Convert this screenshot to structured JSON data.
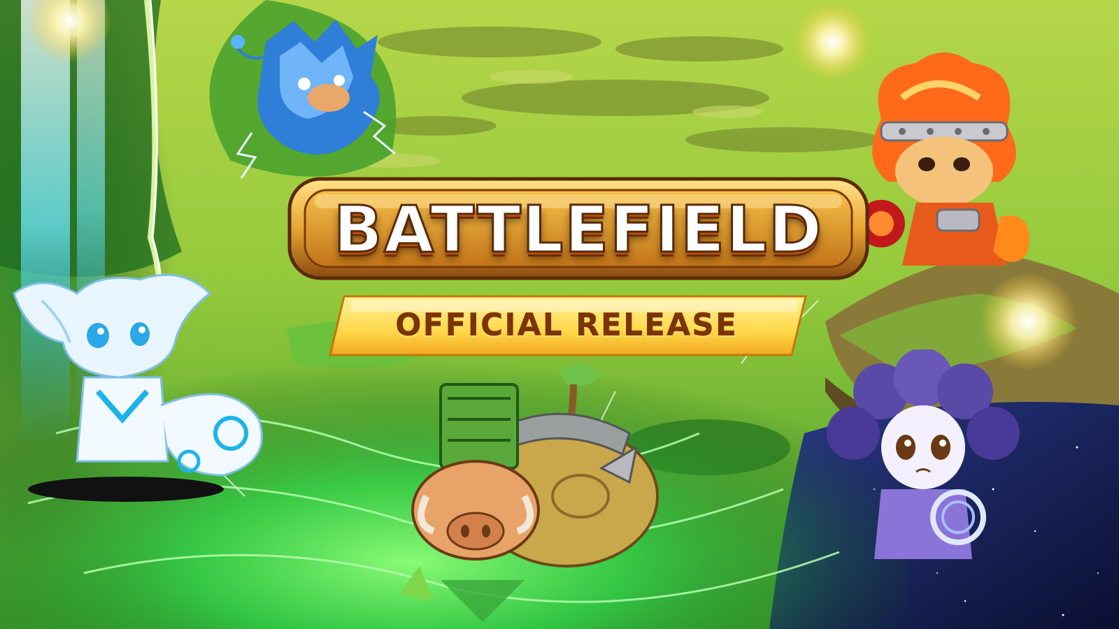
{
  "banner": {
    "title": "BATTLEFIELD",
    "subtitle": "OFFICIAL RELEASE"
  },
  "characters": [
    {
      "id": "water-monster",
      "icon": "water-creature-icon"
    },
    {
      "id": "fire-monster",
      "icon": "fire-creature-icon"
    },
    {
      "id": "ice-fox",
      "icon": "ice-fox-creature-icon"
    },
    {
      "id": "nature-turtle",
      "icon": "nature-turtle-creature-icon"
    },
    {
      "id": "purple-sheep",
      "icon": "purple-sheep-creature-icon"
    }
  ],
  "colors": {
    "title_fill": "#ffffff",
    "title_outline": "#5a2a08",
    "plate_gold": "#e8a630",
    "subtitle_banner": "#ffd84a",
    "subtitle_text": "#7a3406",
    "meadow_green": "#8cc83a",
    "energy_green": "#39e35a",
    "night_sky": "#141a4a"
  }
}
